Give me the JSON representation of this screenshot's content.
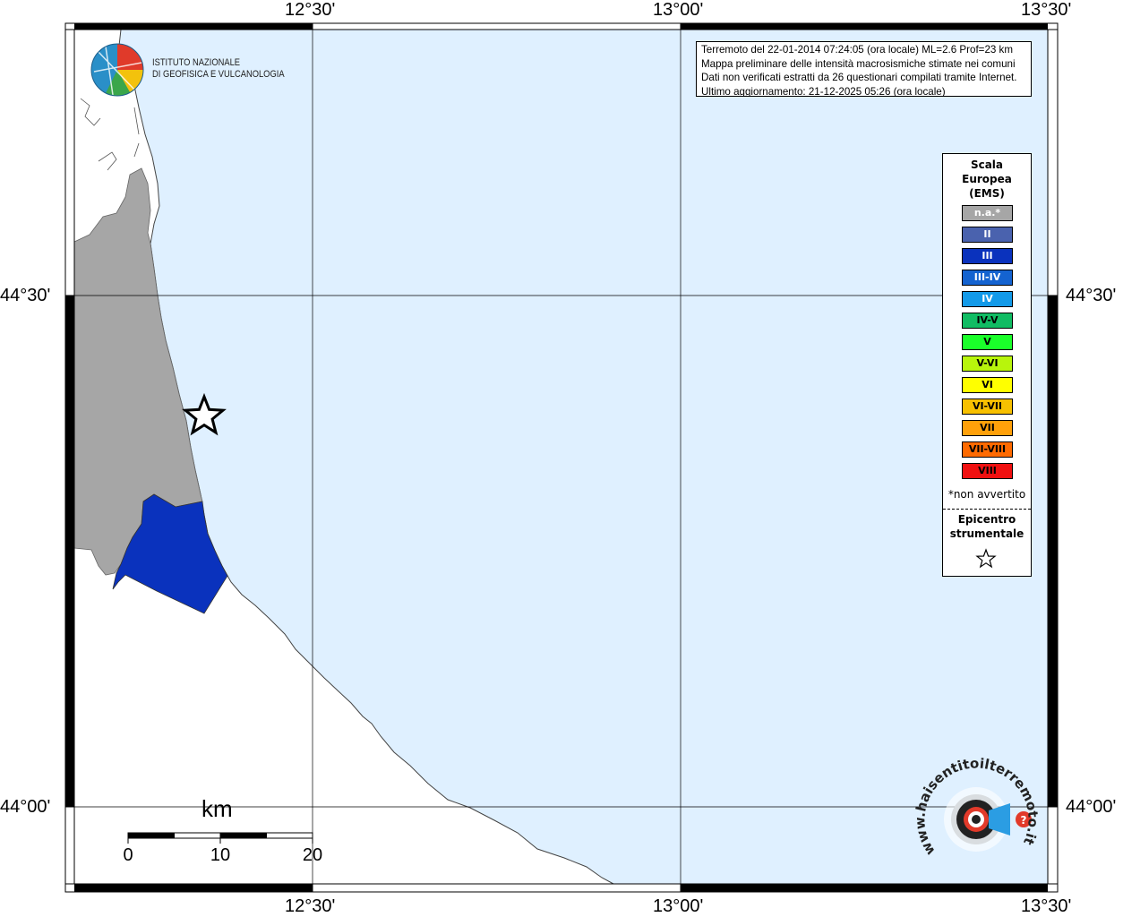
{
  "axes": {
    "longitude_ticks": [
      "12°30'",
      "13°00'",
      "13°30'"
    ],
    "latitude_ticks": [
      "44°30'",
      "44°00'"
    ]
  },
  "info": {
    "lines": [
      "Terremoto del 22-01-2014 07:24:05 (ora locale) ML=2.6 Prof=23 km",
      "Mappa preliminare delle intensità macrosismiche stimate nei comuni",
      "Dati non verificati estratti da 26 questionari compilati tramite Internet.",
      "Ultimo aggiornamento: 21-12-2025 05:26 (ora locale)"
    ]
  },
  "institute": {
    "line1": "ISTITUTO NAZIONALE",
    "line2": "DI GEOFISICA E VULCANOLOGIA"
  },
  "legend": {
    "title": [
      "Scala",
      "Europea",
      "(EMS)"
    ],
    "items": [
      {
        "label": "n.a.*",
        "color": "#a6a6a6",
        "text_color": "#ffffff"
      },
      {
        "label": "II",
        "color": "#4a62ae",
        "text_color": "#ffffff"
      },
      {
        "label": "III",
        "color": "#0a32bd",
        "text_color": "#ffffff"
      },
      {
        "label": "III-IV",
        "color": "#1463d0",
        "text_color": "#ffffff"
      },
      {
        "label": "IV",
        "color": "#139ae9",
        "text_color": "#ffffff"
      },
      {
        "label": "IV-V",
        "color": "#10bc63",
        "text_color": "#000000"
      },
      {
        "label": "V",
        "color": "#1aff2a",
        "text_color": "#000000"
      },
      {
        "label": "V-VI",
        "color": "#b8f50c",
        "text_color": "#000000"
      },
      {
        "label": "VI",
        "color": "#ffff00",
        "text_color": "#000000"
      },
      {
        "label": "VI-VII",
        "color": "#f7c000",
        "text_color": "#000000"
      },
      {
        "label": "VII",
        "color": "#ffa00a",
        "text_color": "#000000"
      },
      {
        "label": "VII-VIII",
        "color": "#ff6a00",
        "text_color": "#000000"
      },
      {
        "label": "VIII",
        "color": "#f01010",
        "text_color": "#000000"
      }
    ],
    "note": "*non avvertito",
    "epicenter_label": [
      "Epicentro",
      "strumentale"
    ]
  },
  "scale_bar": {
    "unit": "km",
    "labels": [
      "0",
      "10",
      "20"
    ]
  },
  "regions": [
    {
      "name": "municipality-north",
      "intensity": "n.a.*",
      "color": "#a6a6a6"
    },
    {
      "name": "municipality-south",
      "intensity": "III",
      "color": "#0a32bd"
    }
  ],
  "colors": {
    "sea": "#dff0ff",
    "land": "#ffffff",
    "frame": "#000000"
  },
  "watermark": {
    "text": "www.haisentitoilterremoto.it"
  }
}
